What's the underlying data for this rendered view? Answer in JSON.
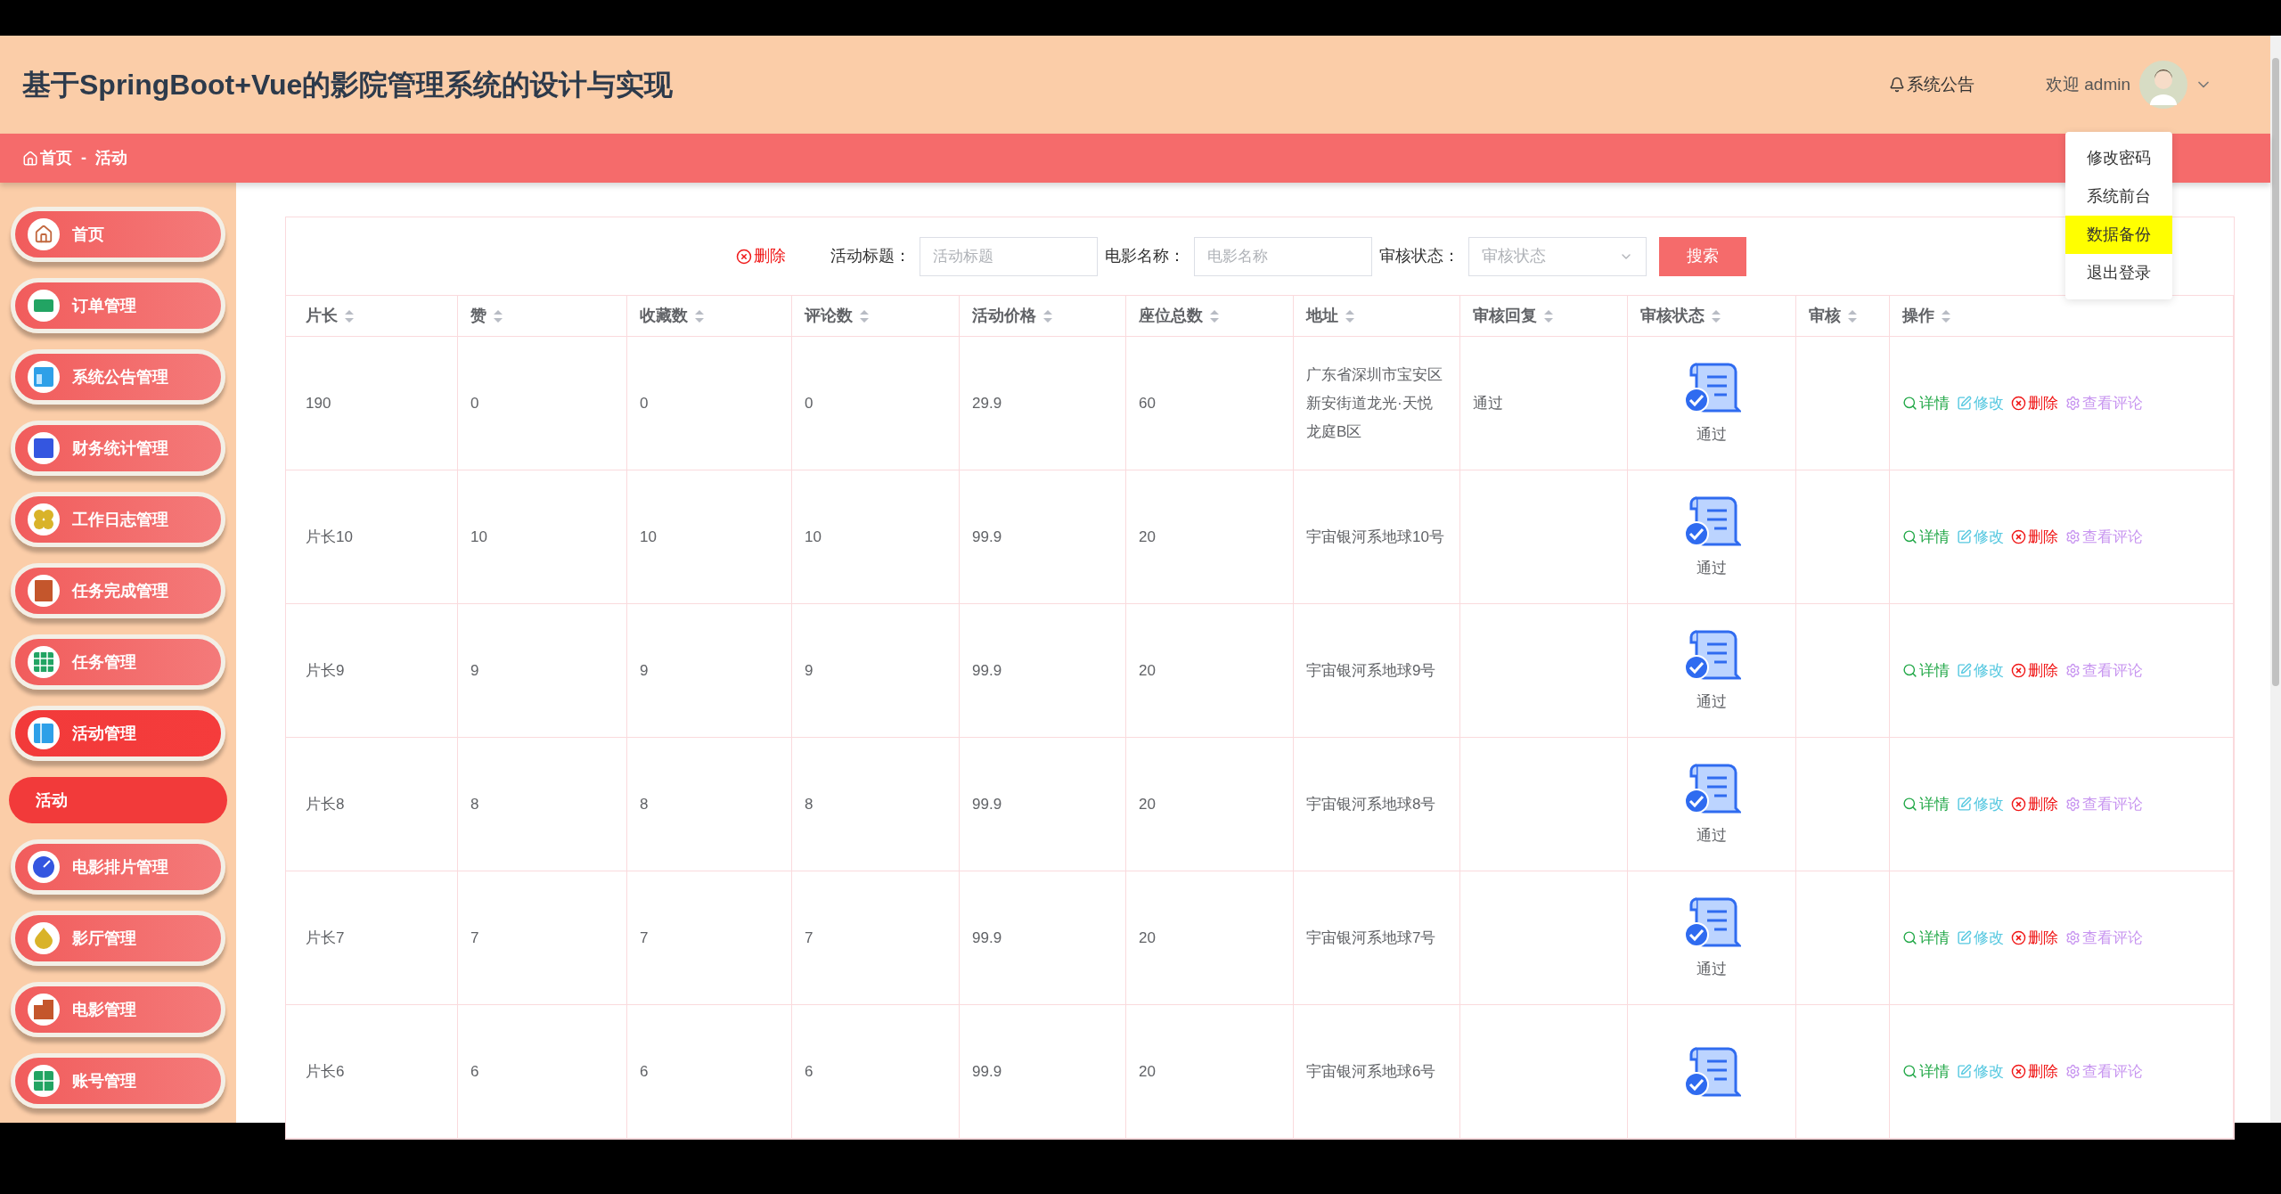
{
  "header": {
    "title": "基于SpringBoot+Vue的影院管理系统的设计与实现",
    "notice": "系统公告",
    "welcome": "欢迎 admin"
  },
  "user_menu": {
    "expanded": true,
    "items": [
      {
        "label": "修改密码",
        "highlighted": false
      },
      {
        "label": "系统前台",
        "highlighted": false
      },
      {
        "label": "数据备份",
        "highlighted": true
      },
      {
        "label": "退出登录",
        "highlighted": false
      }
    ]
  },
  "breadcrumb": {
    "home": "首页",
    "separator": "-",
    "current": "活动"
  },
  "sidebar": {
    "items": [
      {
        "label": "首页",
        "kind": "menu",
        "selected": false
      },
      {
        "label": "订单管理",
        "kind": "menu",
        "selected": false
      },
      {
        "label": "系统公告管理",
        "kind": "menu",
        "selected": false
      },
      {
        "label": "财务统计管理",
        "kind": "menu",
        "selected": false
      },
      {
        "label": "工作日志管理",
        "kind": "menu",
        "selected": false
      },
      {
        "label": "任务完成管理",
        "kind": "menu",
        "selected": false
      },
      {
        "label": "任务管理",
        "kind": "menu",
        "selected": false
      },
      {
        "label": "活动管理",
        "kind": "menu",
        "selected": true
      },
      {
        "label": "活动",
        "kind": "submenu",
        "selected": true
      },
      {
        "label": "电影排片管理",
        "kind": "menu",
        "selected": false
      },
      {
        "label": "影厅管理",
        "kind": "menu",
        "selected": false
      },
      {
        "label": "电影管理",
        "kind": "menu",
        "selected": false
      },
      {
        "label": "账号管理",
        "kind": "menu",
        "selected": false
      }
    ]
  },
  "toolbar": {
    "delete": "删除",
    "filters": [
      {
        "label": "活动标题：",
        "placeholder": "活动标题",
        "kind": "input"
      },
      {
        "label": "电影名称：",
        "placeholder": "电影名称",
        "kind": "input"
      },
      {
        "label": "审核状态：",
        "placeholder": "审核状态",
        "kind": "select"
      }
    ],
    "search": "搜索"
  },
  "table": {
    "columns": [
      "片长",
      "赞",
      "收藏数",
      "评论数",
      "活动价格",
      "座位总数",
      "地址",
      "审核回复",
      "审核状态",
      "审核",
      "操作"
    ],
    "rows": [
      {
        "leader": "190",
        "likes": "0",
        "favorites": "0",
        "comments": "0",
        "price": "29.9",
        "seats": "60",
        "address": "广东省深圳市宝安区新安街道龙光·天悦龙庭B区",
        "reply": "通过",
        "status": "通过",
        "actions": [
          {
            "kind": "detail",
            "label": "详情"
          },
          {
            "kind": "edit",
            "label": "修改"
          },
          {
            "kind": "delete",
            "label": "删除"
          },
          {
            "kind": "comments",
            "label": "查看评论"
          }
        ]
      },
      {
        "leader": "片长10",
        "likes": "10",
        "favorites": "10",
        "comments": "10",
        "price": "99.9",
        "seats": "20",
        "address": "宇宙银河系地球10号",
        "status": "通过",
        "actions": [
          {
            "kind": "detail",
            "label": "详情"
          },
          {
            "kind": "edit",
            "label": "修改"
          },
          {
            "kind": "delete",
            "label": "删除"
          },
          {
            "kind": "comments",
            "label": "查看评论"
          }
        ]
      },
      {
        "leader": "片长9",
        "likes": "9",
        "favorites": "9",
        "comments": "9",
        "price": "99.9",
        "seats": "20",
        "address": "宇宙银河系地球9号",
        "status": "通过",
        "actions": [
          {
            "kind": "detail",
            "label": "详情"
          },
          {
            "kind": "edit",
            "label": "修改"
          },
          {
            "kind": "delete",
            "label": "删除"
          },
          {
            "kind": "comments",
            "label": "查看评论"
          }
        ]
      },
      {
        "leader": "片长8",
        "likes": "8",
        "favorites": "8",
        "comments": "8",
        "price": "99.9",
        "seats": "20",
        "address": "宇宙银河系地球8号",
        "status": "通过",
        "actions": [
          {
            "kind": "detail",
            "label": "详情"
          },
          {
            "kind": "edit",
            "label": "修改"
          },
          {
            "kind": "delete",
            "label": "删除"
          },
          {
            "kind": "comments",
            "label": "查看评论"
          }
        ]
      },
      {
        "leader": "片长7",
        "likes": "7",
        "favorites": "7",
        "comments": "7",
        "price": "99.9",
        "seats": "20",
        "address": "宇宙银河系地球7号",
        "status": "通过",
        "actions": [
          {
            "kind": "detail",
            "label": "详情"
          },
          {
            "kind": "edit",
            "label": "修改"
          },
          {
            "kind": "delete",
            "label": "删除"
          },
          {
            "kind": "comments",
            "label": "查看评论"
          }
        ]
      },
      {
        "leader": "片长6",
        "likes": "6",
        "favorites": "6",
        "comments": "6",
        "price": "99.9",
        "seats": "20",
        "address": "宇宙银河系地球6号",
        "actions": [
          {
            "kind": "detail",
            "label": "详情"
          },
          {
            "kind": "edit",
            "label": "修改"
          },
          {
            "kind": "delete",
            "label": "删除"
          },
          {
            "kind": "comments",
            "label": "查看评论"
          }
        ]
      }
    ]
  }
}
